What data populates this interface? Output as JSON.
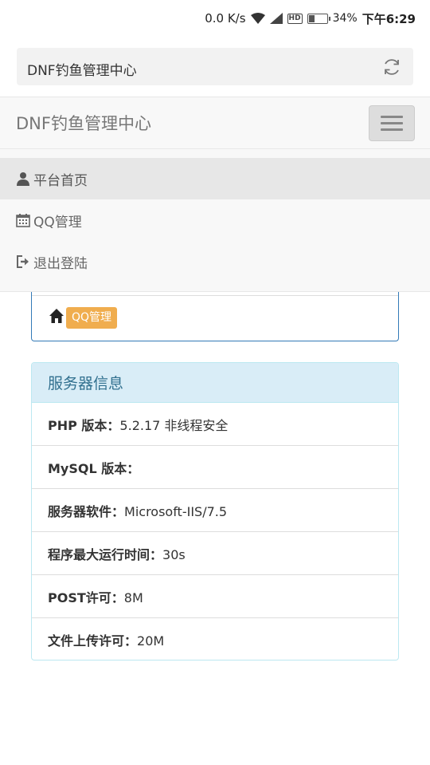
{
  "status_bar": {
    "speed": "0.0 K/s",
    "hd_badge": "HD",
    "battery_percent": "34%",
    "battery_level": 0.34,
    "time": "下午6:29"
  },
  "address_bar": {
    "title": "DNF钓鱼管理中心"
  },
  "navbar": {
    "brand": "DNF钓鱼管理中心"
  },
  "menu": {
    "items": [
      {
        "label": "平台首页",
        "icon": "user-icon",
        "active": true
      },
      {
        "label": "QQ管理",
        "icon": "calendar-icon",
        "active": false
      },
      {
        "label": "退出登陆",
        "icon": "sign-out-icon",
        "active": false
      }
    ]
  },
  "breadcrumb": {
    "label": "QQ管理"
  },
  "server_info": {
    "title": "服务器信息",
    "rows": [
      {
        "key": "PHP 版本：",
        "value": "5.2.17 非线程安全"
      },
      {
        "key": "MySQL 版本：",
        "value": ""
      },
      {
        "key": "服务器软件：",
        "value": "Microsoft-IIS/7.5"
      },
      {
        "key": "程序最大运行时间：",
        "value": "30s"
      },
      {
        "key": "POST许可：",
        "value": "8M"
      },
      {
        "key": "文件上传许可：",
        "value": "20M"
      }
    ]
  },
  "colors": {
    "primary": "#337ab7",
    "warning": "#f0ad4e",
    "info_heading_bg": "#d9edf7",
    "info_heading_text": "#31708f"
  }
}
